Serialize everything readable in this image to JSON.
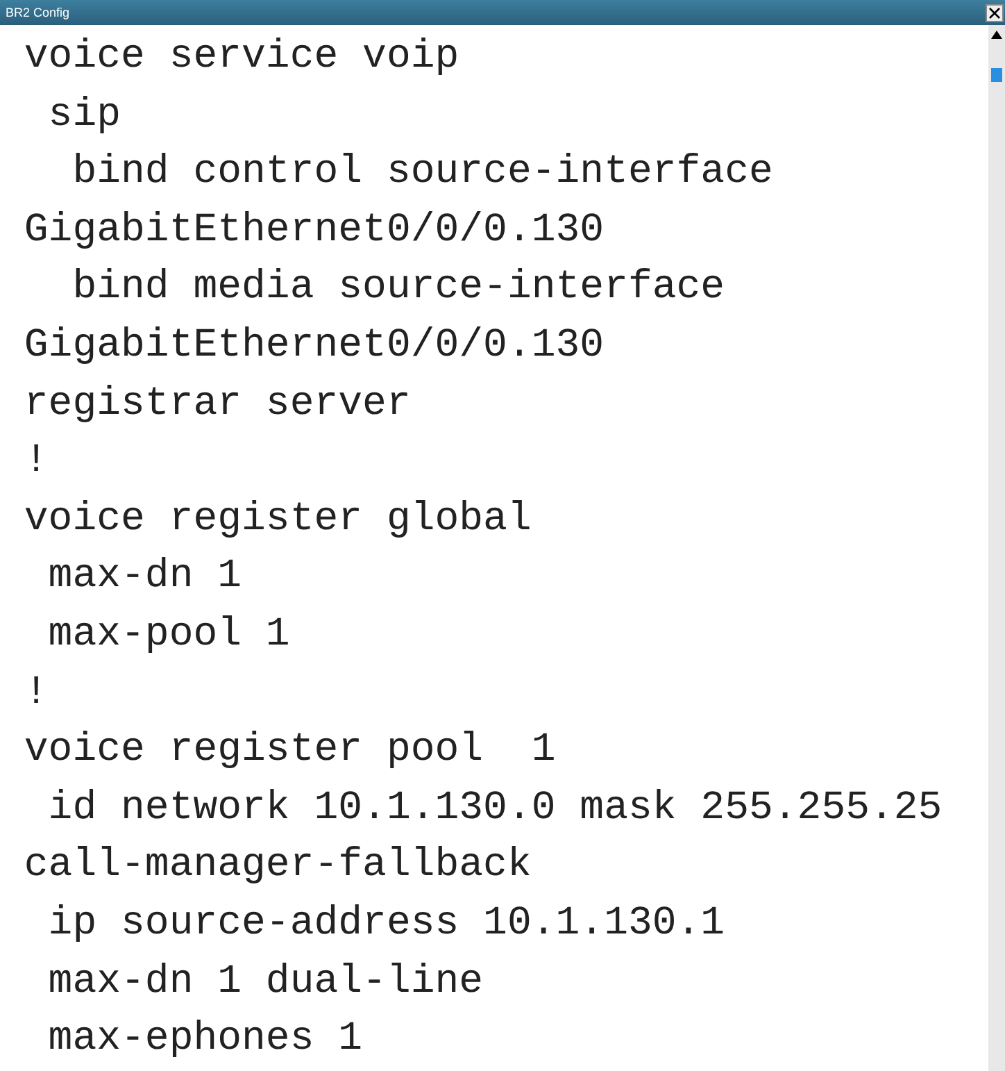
{
  "window": {
    "title": "BR2 Config"
  },
  "lines": [
    " voice service voip",
    "  sip",
    "   bind control source-interface",
    " GigabitEthernet0/0/0.130",
    "   bind media source-interface",
    " GigabitEthernet0/0/0.130",
    " registrar server",
    " !",
    " voice register global",
    "  max-dn 1",
    "  max-pool 1",
    " !",
    " voice register pool  1",
    "  id network 10.1.130.0 mask 255.255.25",
    " call-manager-fallback",
    "  ip source-address 10.1.130.1",
    "  max-dn 1 dual-line",
    "  max-ephones 1"
  ]
}
